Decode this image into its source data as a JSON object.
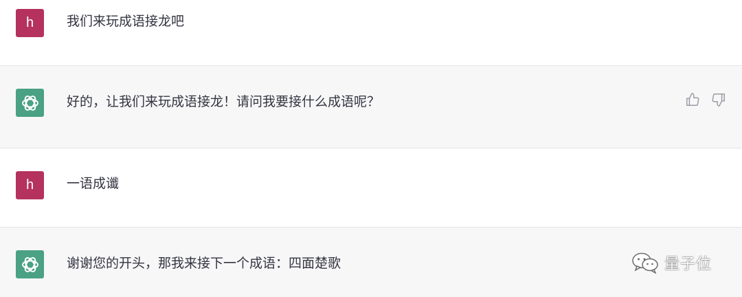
{
  "messages": [
    {
      "role": "user",
      "avatar_letter": "h",
      "text": "我们来玩成语接龙吧"
    },
    {
      "role": "assistant",
      "text": "好的，让我们来玩成语接龙！请问我要接什么成语呢？"
    },
    {
      "role": "user",
      "avatar_letter": "h",
      "text": "一语成谶"
    },
    {
      "role": "assistant",
      "text": "谢谢您的开头，那我来接下一个成语：四面楚歌"
    }
  ],
  "watermark": {
    "text": "量子位",
    "icon": "wechat-icon"
  },
  "icons": {
    "thumbs_up": "thumbs-up-icon",
    "thumbs_down": "thumbs-down-icon",
    "assistant_logo": "openai-logo-icon"
  },
  "colors": {
    "user_avatar": "#b5315e",
    "assistant_avatar": "#4aa184",
    "assistant_row_bg": "#f7f7f8"
  }
}
